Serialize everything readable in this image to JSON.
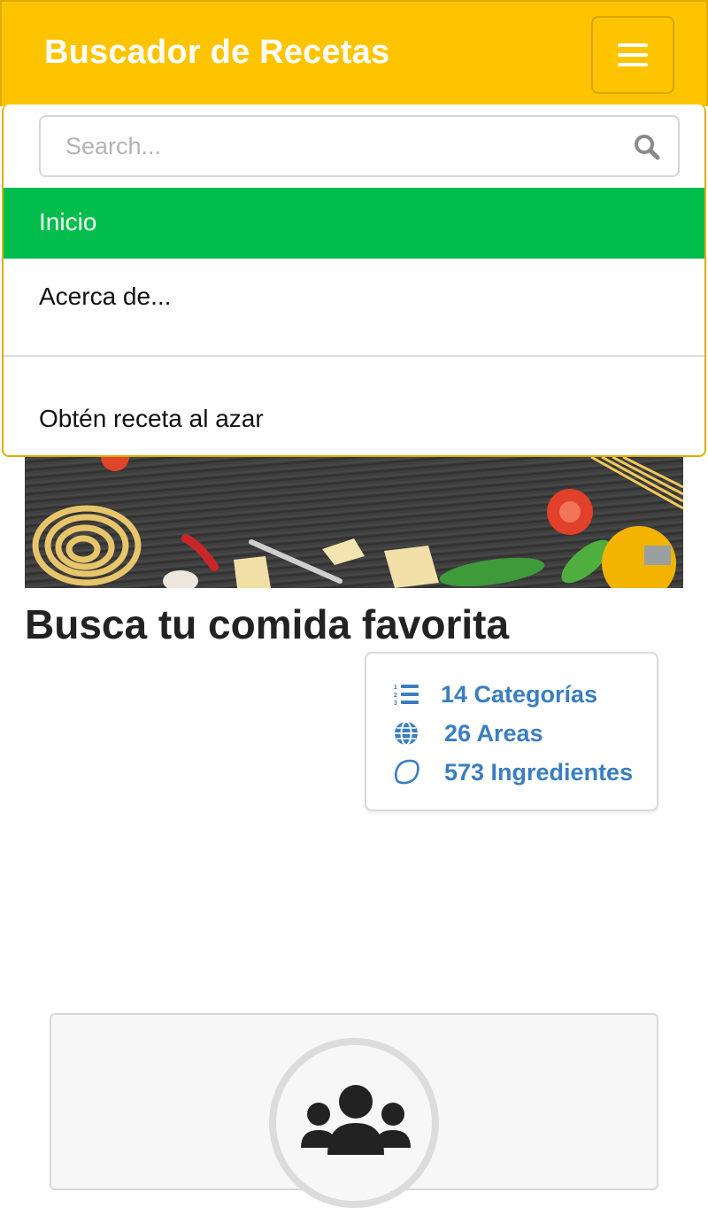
{
  "navbar": {
    "brand": "Buscador de Recetas",
    "toggler_icon": "hamburger-menu-icon",
    "background": "#ffc400"
  },
  "menu": {
    "search": {
      "placeholder": "Search...",
      "value": "",
      "icon": "search-icon"
    },
    "items": [
      {
        "label": "Inicio",
        "active": true
      },
      {
        "label": "Acerca de...",
        "active": false
      },
      {
        "label": "Obtén receta al azar",
        "active": false
      }
    ],
    "active_color": "#00bd4c"
  },
  "main": {
    "heading": "Busca tu comida favorita",
    "stats": [
      {
        "label": "14 Categorías",
        "icon": "list-ordered-icon"
      },
      {
        "label": "26 Areas",
        "icon": "globe-icon"
      },
      {
        "label": "573 Ingredientes",
        "icon": "lemon-icon"
      }
    ],
    "link_color": "#3a7ec1",
    "team_icon": "users-icon"
  }
}
